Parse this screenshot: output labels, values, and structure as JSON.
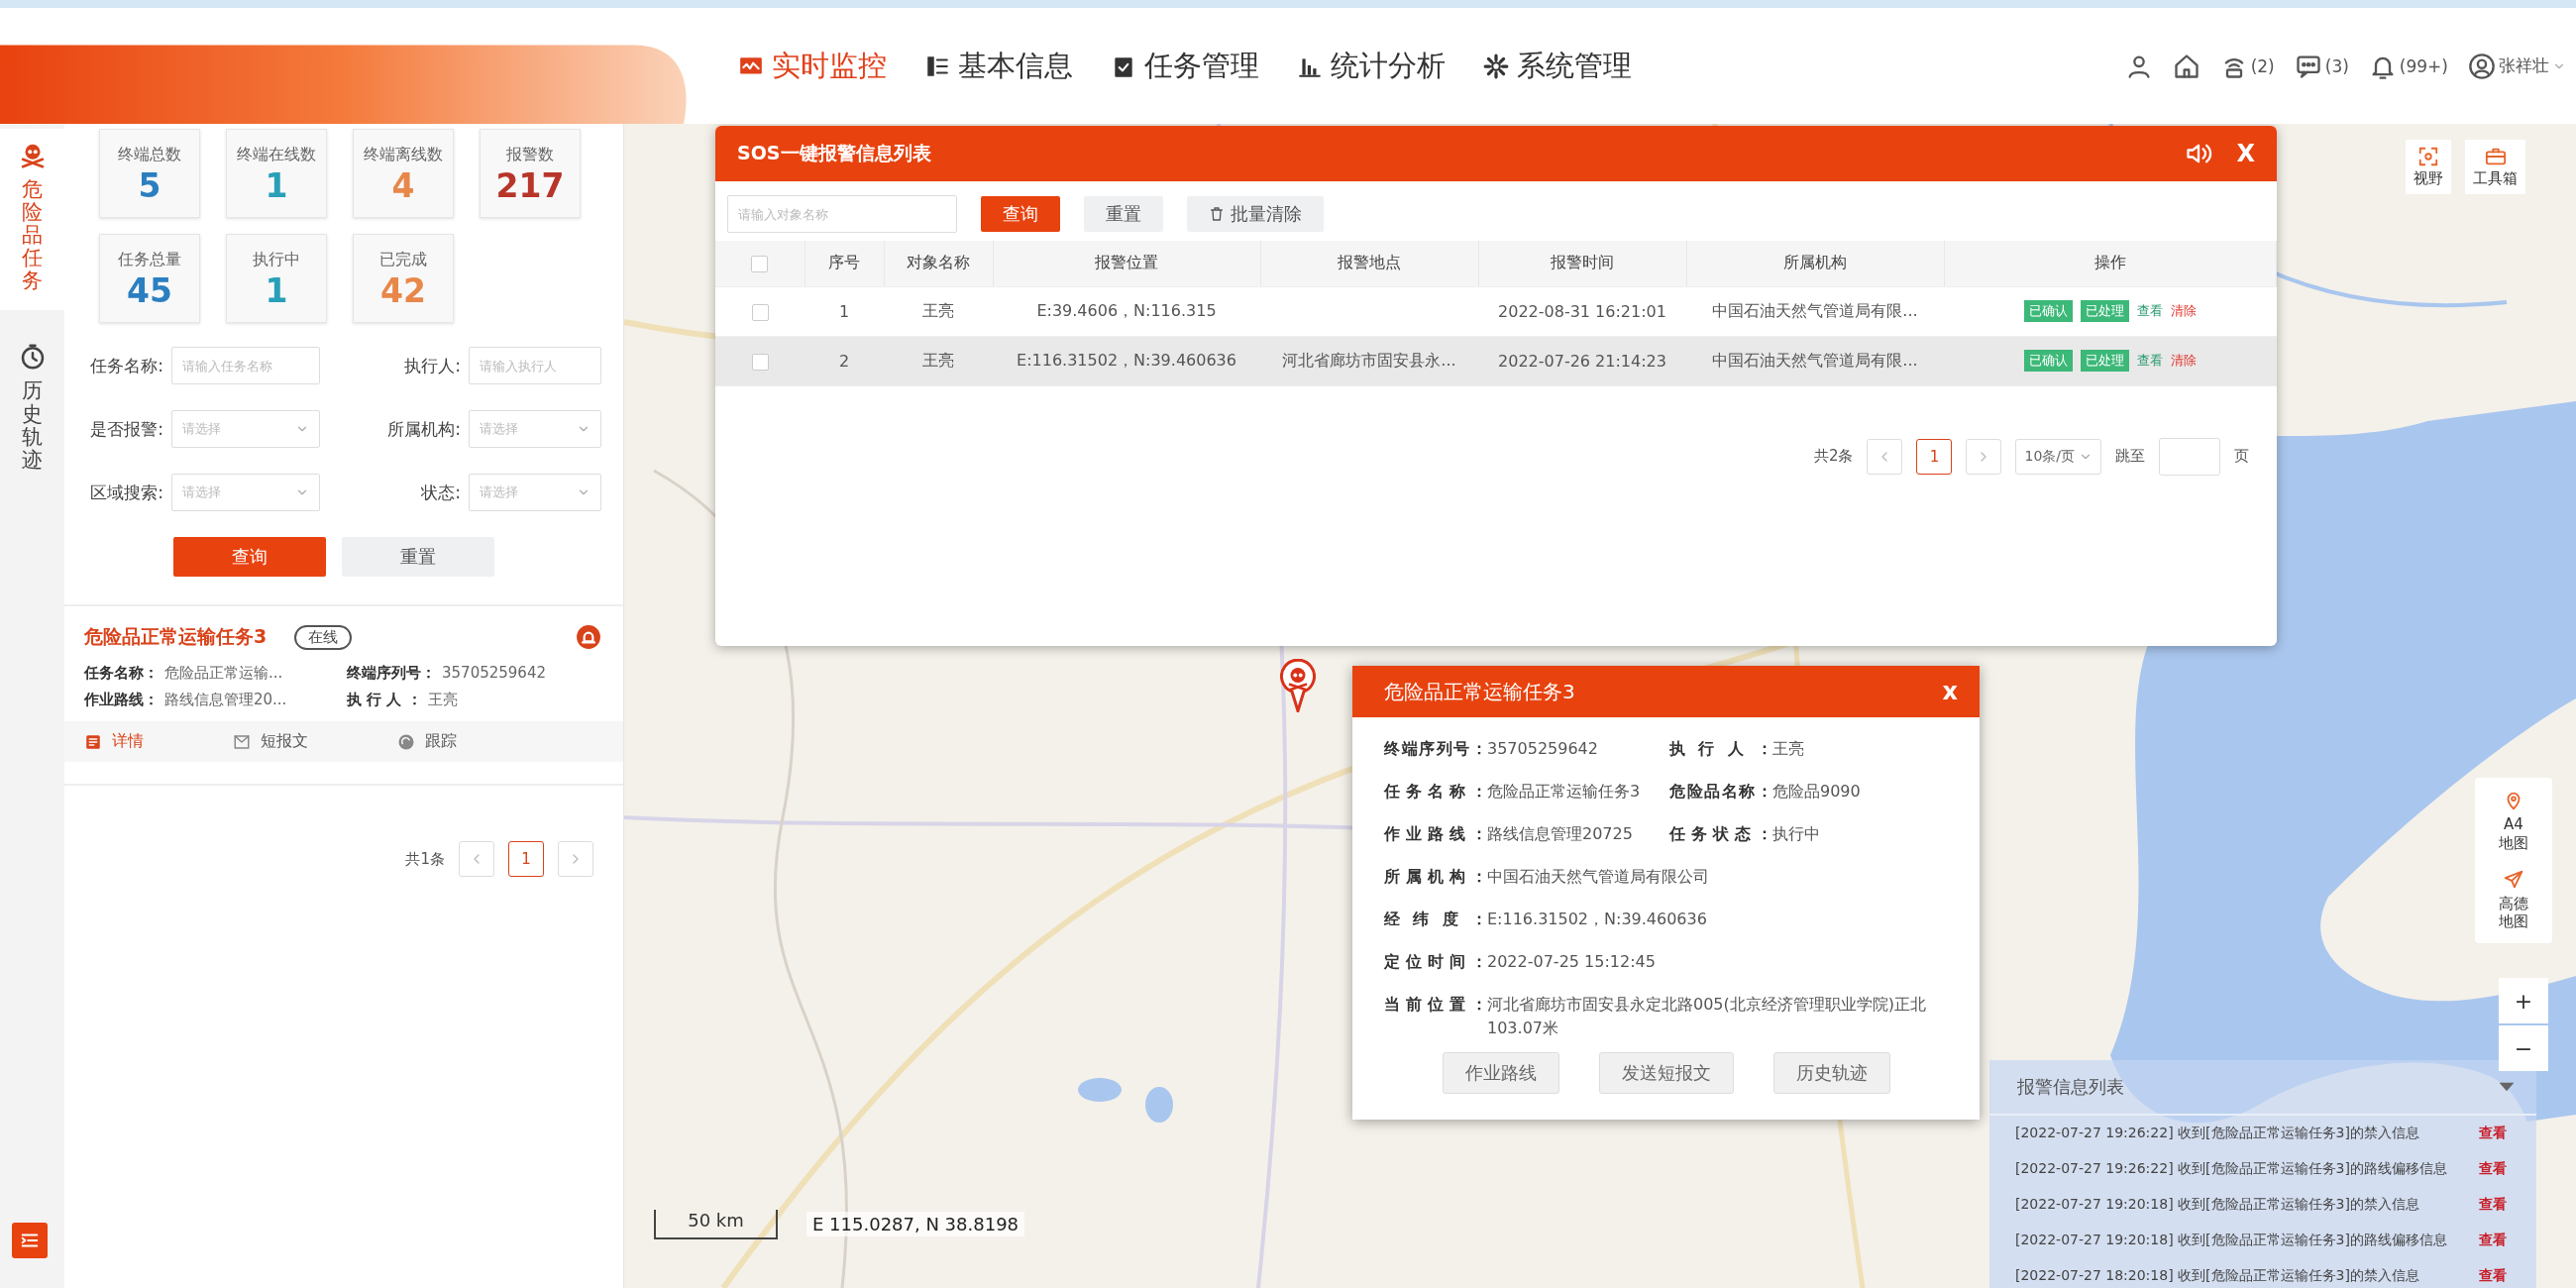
{
  "header": {
    "nav": [
      {
        "label": "实时监控",
        "selected": true
      },
      {
        "label": "基本信息",
        "selected": false
      },
      {
        "label": "任务管理",
        "selected": false
      },
      {
        "label": "统计分析",
        "selected": false
      },
      {
        "label": "系统管理",
        "selected": false
      }
    ],
    "tools": [
      {
        "kind": "person"
      },
      {
        "kind": "home"
      },
      {
        "kind": "sos",
        "count": "(2)"
      },
      {
        "kind": "message",
        "count": "(3)"
      },
      {
        "kind": "bell",
        "count": "(99+)"
      }
    ],
    "user": {
      "name": "张祥壮"
    }
  },
  "sidebar": {
    "items": [
      {
        "label": "危险品任务",
        "selected": true
      },
      {
        "label": "历史轨迹",
        "selected": false
      }
    ]
  },
  "stats": [
    {
      "label": "终端总数",
      "value": "5",
      "color": "#2b7fc1"
    },
    {
      "label": "终端在线数",
      "value": "1",
      "color": "#2a9fb8"
    },
    {
      "label": "终端离线数",
      "value": "4",
      "color": "#e8874a"
    },
    {
      "label": "报警数",
      "value": "217",
      "color": "#b8352a"
    },
    {
      "label": "任务总量",
      "value": "45",
      "color": "#2b7fc1"
    },
    {
      "label": "执行中",
      "value": "1",
      "color": "#2a9fb8"
    },
    {
      "label": "已完成",
      "value": "42",
      "color": "#e8874a"
    }
  ],
  "filters": [
    {
      "label": "任务名称:",
      "kind": "input",
      "placeholder": "请输入任务名称"
    },
    {
      "label": "执行人:",
      "kind": "input",
      "placeholder": "请输入执行人"
    },
    {
      "label": "是否报警:",
      "kind": "select",
      "placeholder": "请选择"
    },
    {
      "label": "所属机构:",
      "kind": "select",
      "placeholder": "请选择"
    },
    {
      "label": "区域搜索:",
      "kind": "select",
      "placeholder": "请选择"
    },
    {
      "label": "状态:",
      "kind": "select",
      "placeholder": "请选择"
    }
  ],
  "filter_buttons": [
    {
      "label": "查询",
      "kind": "primary"
    },
    {
      "label": "重置",
      "kind": "default"
    }
  ],
  "task_card": {
    "title": "危险品正常运输任务3",
    "status": "在线",
    "fields": [
      {
        "label": "任务名称：",
        "value": "危险品正常运输..."
      },
      {
        "label": "终端序列号：",
        "value": "35705259642"
      },
      {
        "label": "作业路线：",
        "value": "路线信息管理20..."
      },
      {
        "label": "执 行 人 ：",
        "value": "王亮"
      }
    ],
    "actions": [
      {
        "label": "详情",
        "selected": true
      },
      {
        "label": "短报文",
        "selected": false
      },
      {
        "label": "跟踪",
        "selected": false
      }
    ]
  },
  "task_pager": {
    "total": "共1条",
    "pages": [
      {
        "label": "1",
        "selected": true
      }
    ]
  },
  "sos_dialog": {
    "title": "SOS一键报警信息列表",
    "close": "X",
    "search": {
      "placeholder": "请输入对象名称"
    },
    "buttons": [
      {
        "label": "查询",
        "kind": "primary"
      },
      {
        "label": "重置",
        "kind": "default"
      },
      {
        "label": "批量清除",
        "kind": "trash"
      }
    ],
    "header_checked": false,
    "columns": [
      "序号",
      "对象名称",
      "报警位置",
      "报警地点",
      "报警时间",
      "所属机构",
      "操作"
    ],
    "rows": [
      {
        "checked": false,
        "selected": false,
        "index": "1",
        "name": "王亮",
        "position": "E:39.4606，N:116.315",
        "time": "2022-08-31 16:21:01",
        "org": "中国石油天然气管道局有限...",
        "actions": [
          {
            "label": "已确认",
            "kind": "tag"
          },
          {
            "label": "已处理",
            "kind": "tag"
          },
          {
            "label": "查看",
            "kind": "link"
          },
          {
            "label": "清除",
            "kind": "danger"
          }
        ]
      },
      {
        "checked": false,
        "selected": true,
        "index": "2",
        "name": "王亮",
        "position": "E:116.31502，N:39.460636",
        "place": "河北省廊坊市固安县永...",
        "time": "2022-07-26 21:14:23",
        "org": "中国石油天然气管道局有限...",
        "actions": [
          {
            "label": "已确认",
            "kind": "tag"
          },
          {
            "label": "已处理",
            "kind": "tag"
          },
          {
            "label": "查看",
            "kind": "link"
          },
          {
            "label": "清除",
            "kind": "danger"
          }
        ]
      }
    ],
    "pager": {
      "total": "共2条",
      "pages": [
        {
          "label": "1",
          "selected": true
        }
      ],
      "page_size": "10条/页",
      "jump_label": "跳至",
      "jump_suffix": "页"
    }
  },
  "popup": {
    "title": "危险品正常运输任务3",
    "close": "x",
    "rows": [
      {
        "fields": [
          {
            "label": "终端序列号：",
            "value": "35705259642"
          },
          {
            "label": "执 行 人 ：",
            "value": "王亮"
          }
        ]
      },
      {
        "fields": [
          {
            "label": "任务名称：",
            "value": "危险品正常运输任务3"
          },
          {
            "label": "危险品名称：",
            "value": "危险品9090"
          }
        ]
      },
      {
        "fields": [
          {
            "label": "作业路线：",
            "value": "路线信息管理20725"
          },
          {
            "label": "任务状态：",
            "value": "执行中"
          }
        ]
      },
      {
        "fields": [
          {
            "label": "所属机构：",
            "value": "中国石油天然气管道局有限公司"
          }
        ]
      },
      {
        "fields": [
          {
            "label": "经 纬 度 ：",
            "value": "E:116.31502，N:39.460636"
          }
        ]
      },
      {
        "fields": [
          {
            "label": "定位时间：",
            "value": "2022-07-25 15:12:45"
          }
        ]
      },
      {
        "fields": [
          {
            "label": "当前位置：",
            "value": "河北省廊坊市固安县永定北路005(北京经济管理职业学院)正北103.07米"
          }
        ]
      }
    ],
    "buttons": [
      "作业路线",
      "发送短报文",
      "历史轨迹"
    ]
  },
  "alerts": {
    "title": "报警信息列表",
    "items": [
      {
        "text": "[2022-07-27 19:26:22] 收到[危险品正常运输任务3]的禁入信息",
        "action": "查看"
      },
      {
        "text": "[2022-07-27 19:26:22] 收到[危险品正常运输任务3]的路线偏移信息",
        "action": "查看"
      },
      {
        "text": "[2022-07-27 19:20:18] 收到[危险品正常运输任务3]的禁入信息",
        "action": "查看"
      },
      {
        "text": "[2022-07-27 19:20:18] 收到[危险品正常运输任务3]的路线偏移信息",
        "action": "查看"
      },
      {
        "text": "[2022-07-27 18:20:18] 收到[危险品正常运输任务3]的禁入信息",
        "action": "查看"
      }
    ]
  },
  "map_tools": [
    {
      "label": "视野"
    },
    {
      "label": "工具箱"
    }
  ],
  "map_layers": [
    {
      "label": "A4地图"
    },
    {
      "label": "高德地图"
    }
  ],
  "zoom": [
    "+",
    "−"
  ],
  "scale": {
    "label": "50 km",
    "coordinates": "E 115.0287, N 38.8198"
  }
}
